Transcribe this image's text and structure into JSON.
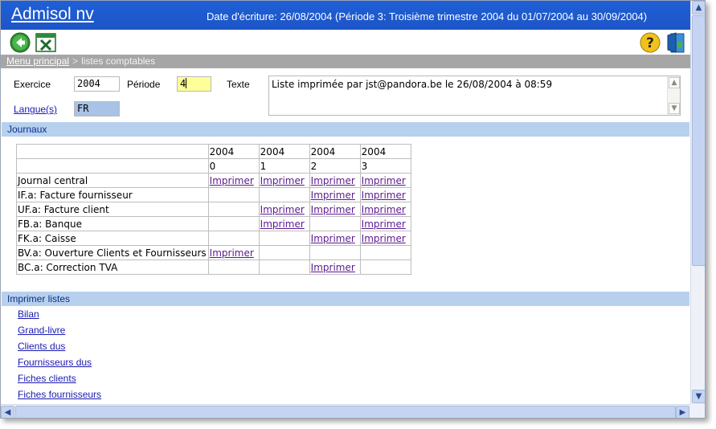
{
  "app": {
    "title": "Admisol nv",
    "header_info": "Date d'écriture: 26/08/2004 (Période 3: Troisième trimestre 2004 du 01/07/2004 au 30/09/2004)"
  },
  "toolbar": {
    "back_icon": "back-arrow-icon",
    "excel_icon": "excel-icon",
    "help_icon": "help-icon",
    "exit_icon": "exit-door-icon"
  },
  "breadcrumb": {
    "home": "Menu principal",
    "separator": ">",
    "current": "listes comptables"
  },
  "form": {
    "exercice_label": "Exercice",
    "exercice_value": "2004",
    "periode_label": "Période",
    "periode_value": "4",
    "texte_label": "Texte",
    "texte_value": "Liste imprimée par jst@pandora.be le 26/08/2004 à 08:59",
    "langue_label": "Langue(s)",
    "langue_value": "FR"
  },
  "journaux": {
    "section_title": "Journaux",
    "columns": [
      {
        "year": "2004",
        "period": "0"
      },
      {
        "year": "2004",
        "period": "1"
      },
      {
        "year": "2004",
        "period": "2"
      },
      {
        "year": "2004",
        "period": "3"
      }
    ],
    "print_label": "Imprimer",
    "rows": [
      {
        "name": "Journal central",
        "cells": [
          true,
          true,
          true,
          true
        ]
      },
      {
        "name": "IF.a: Facture fournisseur",
        "cells": [
          false,
          false,
          true,
          true
        ]
      },
      {
        "name": "UF.a: Facture client",
        "cells": [
          false,
          true,
          true,
          true
        ]
      },
      {
        "name": "FB.a: Banque",
        "cells": [
          false,
          true,
          false,
          true
        ]
      },
      {
        "name": "FK.a: Caisse",
        "cells": [
          false,
          false,
          true,
          true
        ]
      },
      {
        "name": "BV.a: Ouverture Clients et Fournisseurs",
        "cells": [
          true,
          false,
          false,
          false
        ]
      },
      {
        "name": "BC.a: Correction TVA",
        "cells": [
          false,
          false,
          true,
          false
        ]
      }
    ]
  },
  "imprimer_listes": {
    "section_title": "Imprimer listes",
    "items": [
      "Bilan",
      "Grand-livre",
      "Clients dus",
      "Fournisseurs dus",
      "Fiches clients",
      "Fiches fournisseurs"
    ]
  },
  "colors": {
    "titlebar": "#1f5fd6",
    "section_bar": "#b7d0ee",
    "breadcrumb_bar": "#a6a6a6",
    "periode_field": "#ffff9a",
    "langue_field": "#a9c3e6",
    "imprimer_link": "#5b1a8e"
  }
}
